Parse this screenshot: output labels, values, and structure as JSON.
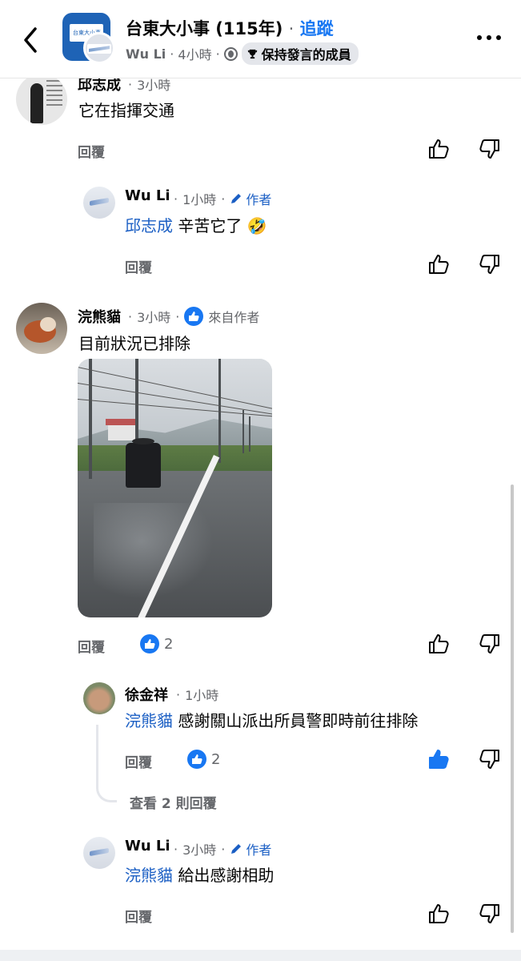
{
  "header": {
    "group_name": "台東大小事 (115年)",
    "separator": "·",
    "follow_label": "追蹤",
    "author_name": "Wu Li",
    "post_time": "4小時",
    "badge_label": "保持發言的成員",
    "group_logo_text": "台東大小事"
  },
  "comments": [
    {
      "name": "邱志成",
      "time": "3小時",
      "text": "它在指揮交通",
      "reply_label": "回覆"
    },
    {
      "name": "Wu Li",
      "time": "1小時",
      "author_label": "作者",
      "mention": "邱志成",
      "text": "辛苦它了",
      "emoji": "🤣",
      "reply_label": "回覆"
    },
    {
      "name": "浣熊貓",
      "time": "3小時",
      "from_author_label": "來自作者",
      "text": "目前狀況已排除",
      "reply_label": "回覆",
      "like_count": "2"
    },
    {
      "name": "徐金祥",
      "time": "1小時",
      "mention": "浣熊貓",
      "text": "感謝關山派出所員警即時前往排除",
      "reply_label": "回覆",
      "like_count": "2",
      "view_replies": "查看 2 則回覆"
    },
    {
      "name": "Wu Li",
      "time": "3小時",
      "author_label": "作者",
      "mention": "浣熊貓",
      "text": "給出感謝相助",
      "reply_label": "回覆"
    }
  ],
  "colors": {
    "accent": "#1877f2",
    "mention": "#1b5fc4",
    "muted": "#65676b"
  }
}
